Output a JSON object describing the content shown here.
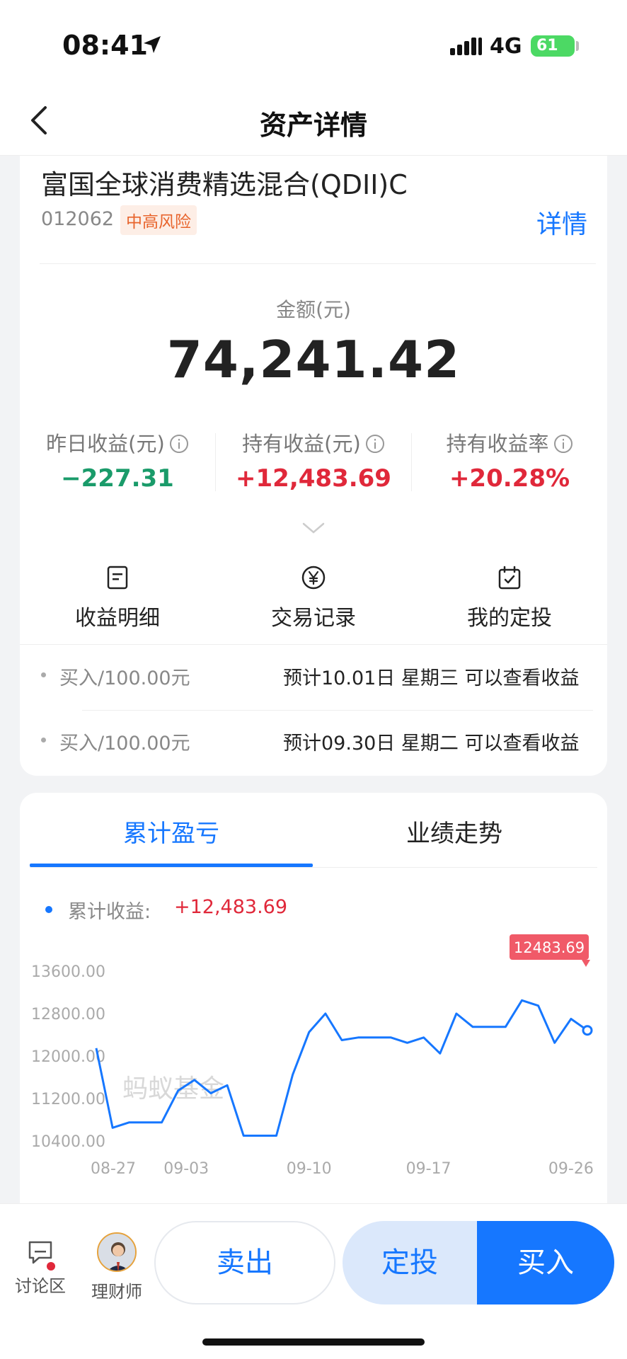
{
  "status_bar": {
    "time": "08:41",
    "network": "4G",
    "battery": "61"
  },
  "nav": {
    "title": "资产详情"
  },
  "fund": {
    "name": "富国全球消费精选混合(QDII)C",
    "code": "012062",
    "risk_tag": "中高风险",
    "detail_link": "详情"
  },
  "amount": {
    "label": "金额(元)",
    "value": "74,241.42"
  },
  "metrics": [
    {
      "label": "昨日收益(元)",
      "value": "−227.31"
    },
    {
      "label": "持有收益(元)",
      "value": "+12,483.69"
    },
    {
      "label": "持有收益率",
      "value": "+20.28%"
    }
  ],
  "actions": [
    {
      "label": "收益明细",
      "icon": "doc-icon"
    },
    {
      "label": "交易记录",
      "icon": "yen-icon"
    },
    {
      "label": "我的定投",
      "icon": "calendar-icon"
    }
  ],
  "pending": [
    {
      "type": "买入/100.00元",
      "desc": "预计10.01日 星期三 可以查看收益"
    },
    {
      "type": "买入/100.00元",
      "desc": "预计09.30日 星期二 可以查看收益"
    }
  ],
  "tabs": [
    "累计盈亏",
    "业绩走势"
  ],
  "legend": {
    "label": "累计收益:",
    "value": "+12,483.69"
  },
  "chart_data": {
    "type": "line",
    "y_ticks": [
      "13600.00",
      "12800.00",
      "12000.00",
      "11200.00",
      "10400.00"
    ],
    "x_ticks": [
      "08-27",
      "09-03",
      "09-10",
      "09-17",
      "09-26"
    ],
    "ylim": [
      10400,
      13600
    ],
    "series": [
      {
        "values": [
          12150,
          10650,
          10750,
          10750,
          10750,
          11350,
          11550,
          11300,
          11450,
          10500,
          10500,
          10500,
          11650,
          12450,
          12800,
          12300,
          12350,
          12350,
          12350,
          12250,
          12350,
          12050,
          12800,
          12550,
          12550,
          12550,
          13050,
          12950,
          12250,
          12700,
          12483.69
        ]
      }
    ],
    "last_value_label": "12483.69",
    "watermark": "蚂蚁基金",
    "color": "#1677ff"
  },
  "bottom_bar": {
    "discuss_label": "讨论区",
    "advisor_label": "理财师",
    "sell_label": "卖出",
    "sip_label": "定投",
    "buy_label": "买入"
  }
}
